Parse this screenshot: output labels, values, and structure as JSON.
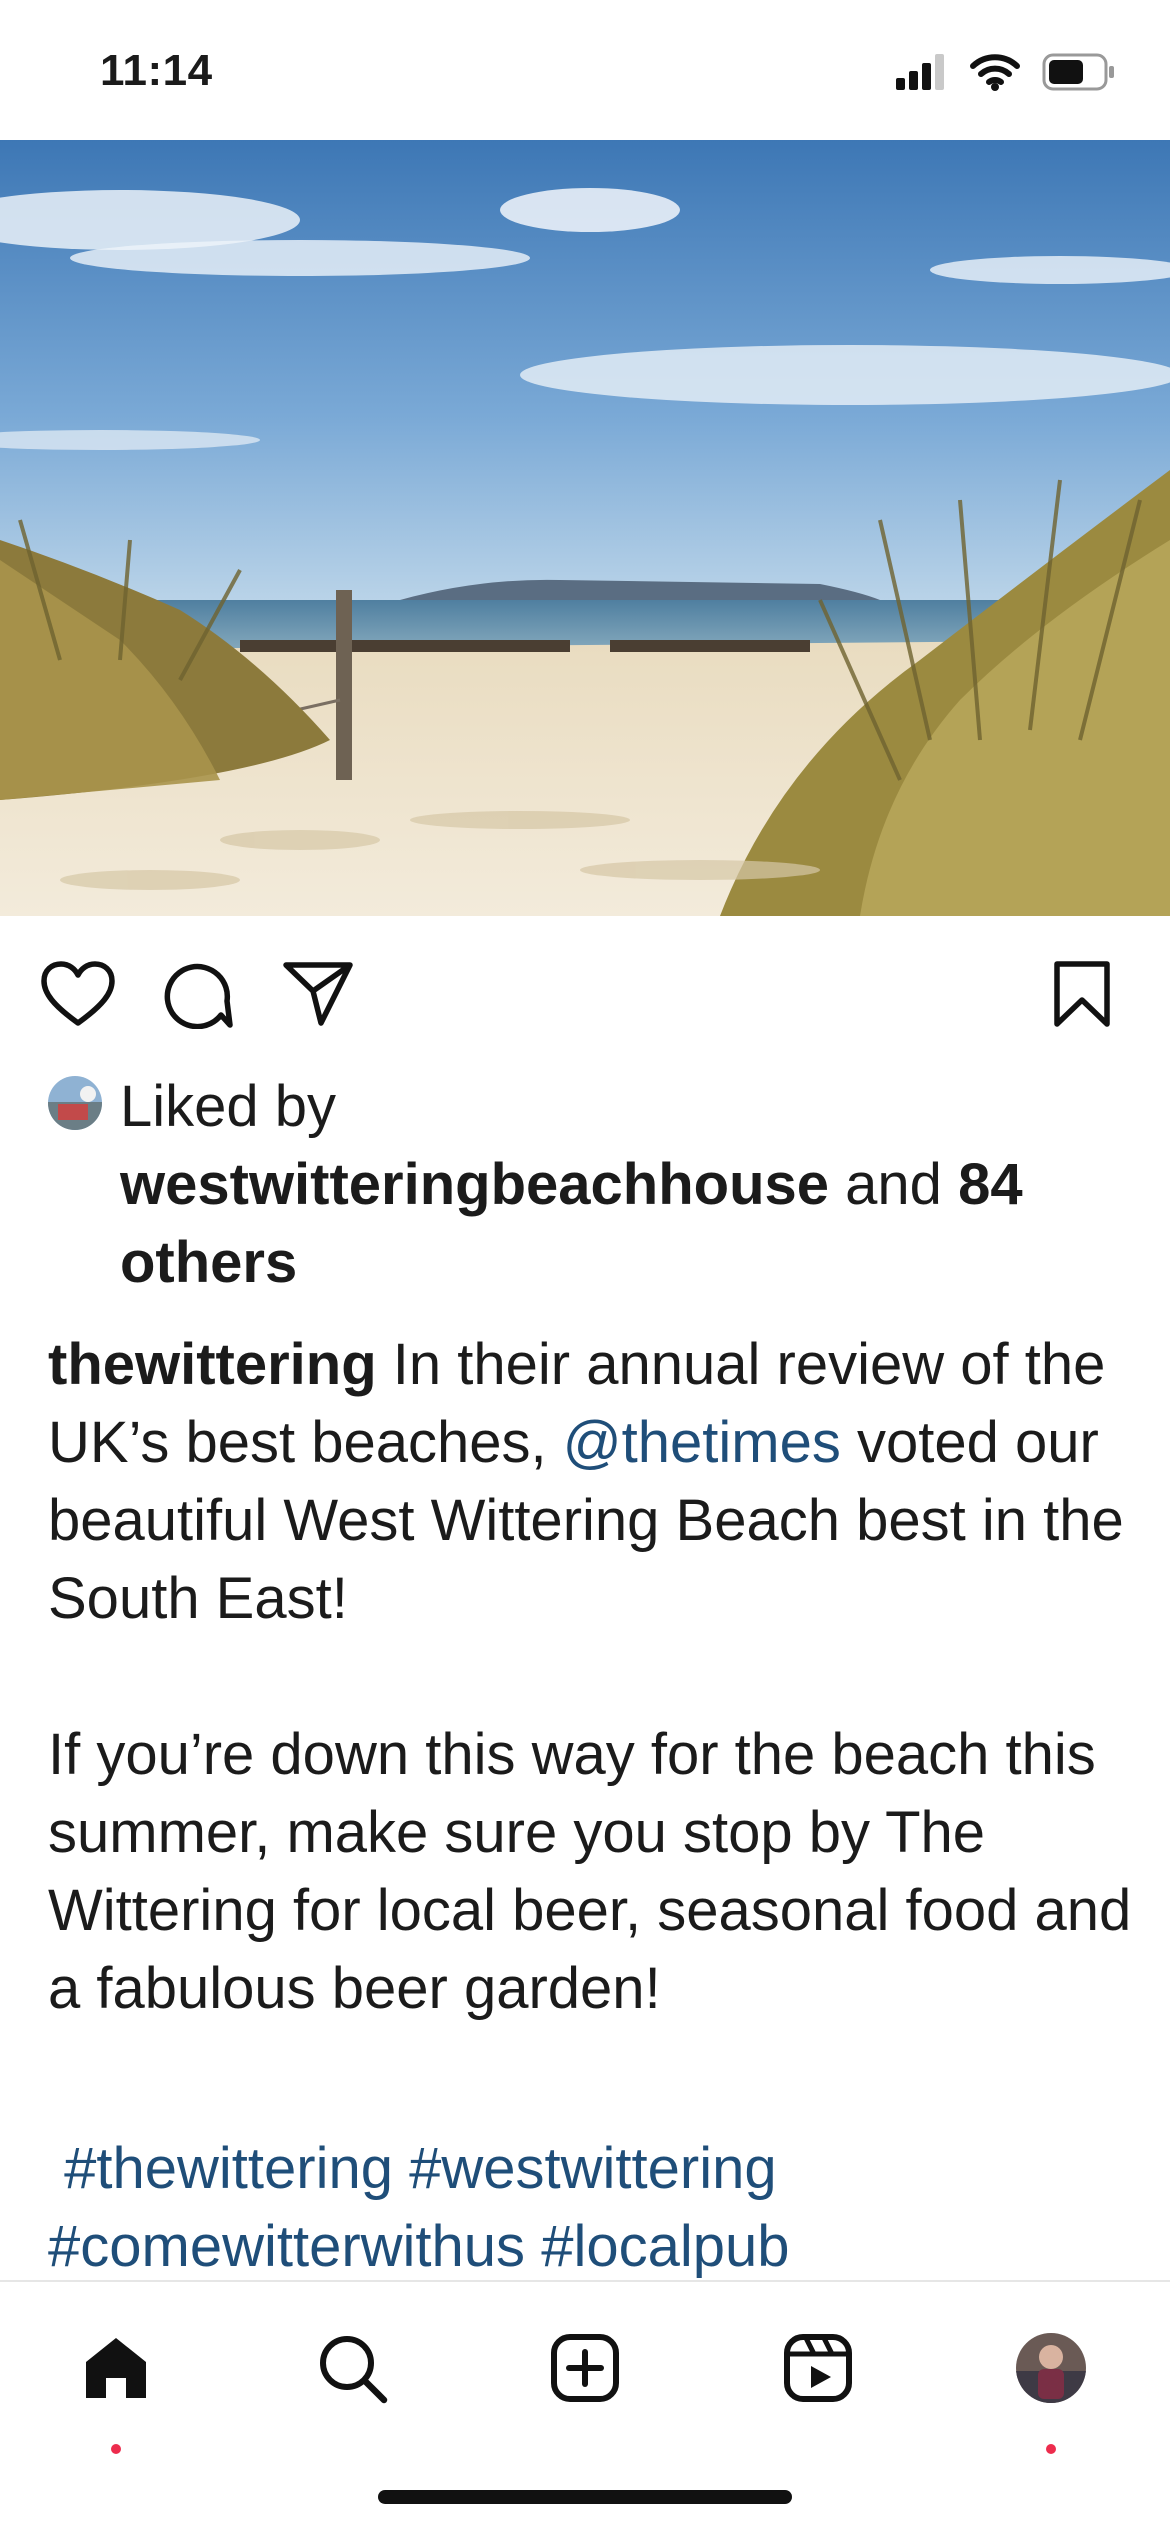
{
  "status_bar": {
    "time": "11:14",
    "icons": [
      "signal-icon",
      "wifi-icon",
      "battery-icon"
    ]
  },
  "post": {
    "image_description_icon": "beach-photo",
    "actions": {
      "like_icon": "heart-icon",
      "comment_icon": "comment-icon",
      "share_icon": "send-icon",
      "save_icon": "bookmark-icon"
    },
    "likes": {
      "prefix": "Liked by",
      "user": "westwitteringbeachhouse",
      "joiner": "and",
      "count_text": "84 others"
    },
    "caption": {
      "username": "thewittering",
      "line1_pre": "In their annual review of the UK’s best beaches,",
      "mention": "@thetimes",
      "line1_post": "voted our beautiful West Wittering Beach best in the South East!",
      "paragraph2": "If you’re down this way for the beach this summer, make sure you stop by The Wittering for local beer, seasonal food and a fabulous beer garden!",
      "hashtags": [
        "#thewittering",
        "#westwittering",
        "#comewitterwithus",
        "#localpub"
      ]
    }
  },
  "tab_bar": {
    "tabs": [
      "home-icon",
      "search-icon",
      "create-icon",
      "reels-icon",
      "profile-avatar"
    ],
    "accent_dot": "#ed2c4d"
  },
  "colors": {
    "link": "#1f4e79",
    "text": "#1b1b1b"
  }
}
